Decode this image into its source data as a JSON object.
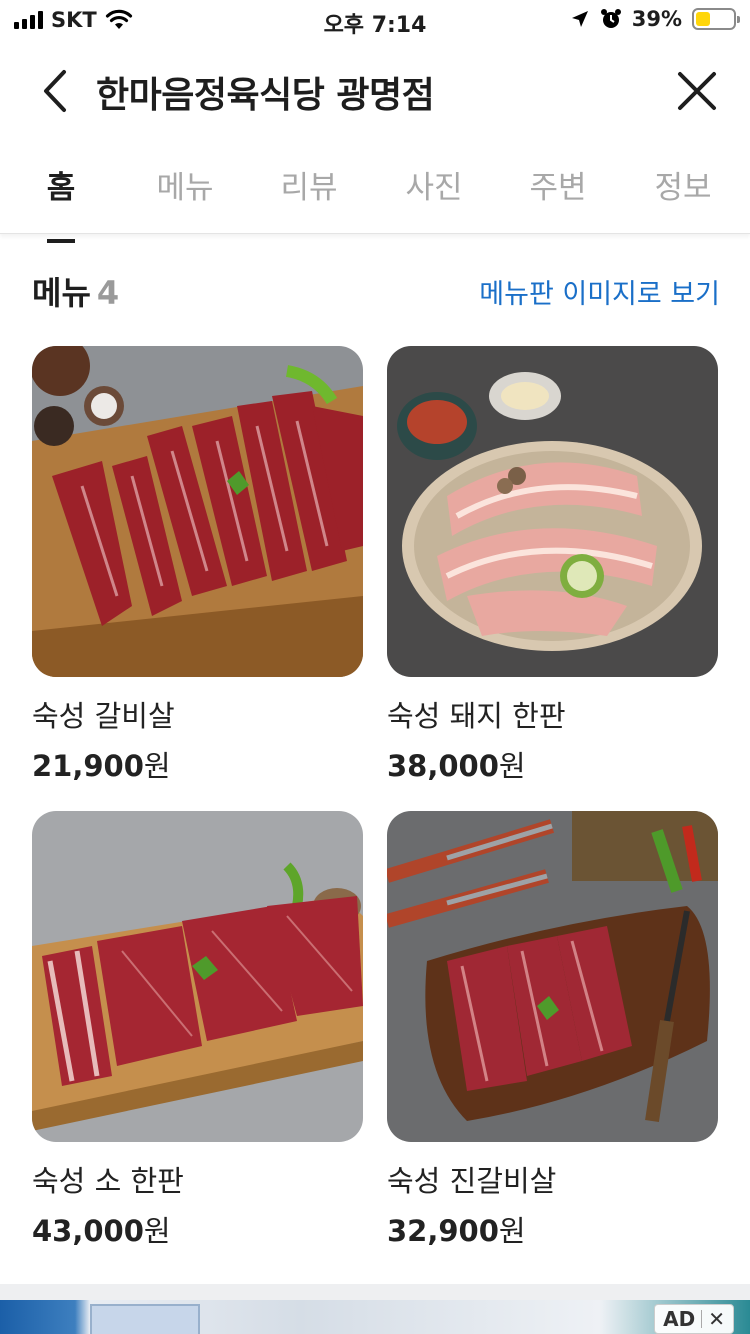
{
  "status_bar": {
    "carrier": "SKT",
    "time": "오후 7:14",
    "battery_percent": "39%",
    "battery_level": 0.39,
    "icons": [
      "signal-icon",
      "wifi-icon",
      "location-arrow-icon",
      "alarm-clock-icon",
      "battery-icon"
    ]
  },
  "header": {
    "title": "한마음정육식당 광명점",
    "back_icon": "chevron-left-icon",
    "close_icon": "close-icon"
  },
  "tabs": [
    {
      "label": "홈",
      "active": true
    },
    {
      "label": "메뉴",
      "active": false
    },
    {
      "label": "리뷰",
      "active": false
    },
    {
      "label": "사진",
      "active": false
    },
    {
      "label": "주변",
      "active": false
    },
    {
      "label": "정보",
      "active": false
    }
  ],
  "menu_section": {
    "title": "메뉴",
    "count": "4",
    "view_image_link": "메뉴판 이미지로 보기",
    "items": [
      {
        "name": "숙성 갈비살",
        "price": "21,900",
        "currency": "원"
      },
      {
        "name": "숙성 돼지 한판",
        "price": "38,000",
        "currency": "원"
      },
      {
        "name": "숙성 소 한판",
        "price": "43,000",
        "currency": "원"
      },
      {
        "name": "숙성 진갈비살",
        "price": "32,900",
        "currency": "원"
      }
    ]
  },
  "ad": {
    "label": "AD",
    "close_symbol": "✕"
  },
  "colors": {
    "link": "#1a6fc8",
    "active_tab": "#1e1e1e",
    "inactive_tab": "#a8a8a8",
    "battery_fill": "#ffd60a"
  }
}
